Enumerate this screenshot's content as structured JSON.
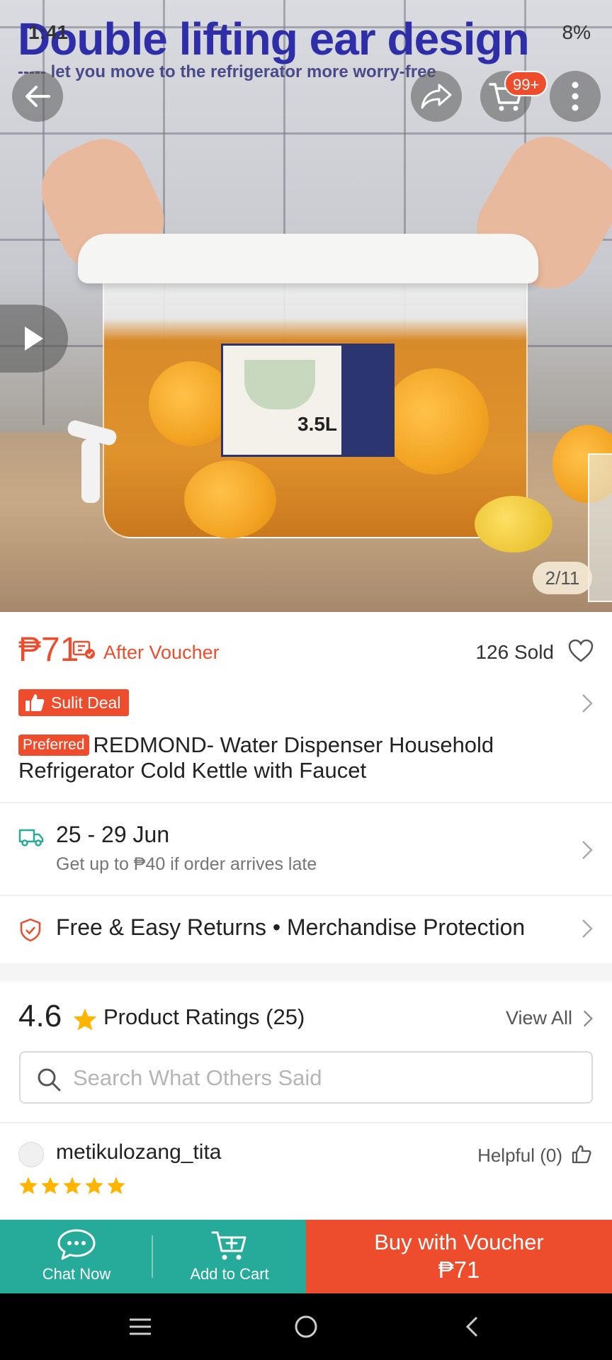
{
  "status_bar": {
    "time": "1:41",
    "battery": "8%"
  },
  "hero": {
    "overlay_title": "Double lifting ear design",
    "overlay_subtitle": "----- let you move to the refrigerator more worry-free",
    "cart_badge": "99+",
    "image_counter": "2/11",
    "label_size": "3.5L"
  },
  "product": {
    "price": "₱71",
    "after_voucher": "After Voucher",
    "sold": "126 Sold",
    "sulit_deal": "Sulit Deal",
    "preferred_tag": "Preferred",
    "title": "REDMOND- Water Dispenser Household Refrigerator Cold Kettle with Faucet"
  },
  "shipping": {
    "date_range": "25 - 29 Jun",
    "guarantee": "Get up to ₱40 if order arrives late"
  },
  "returns": {
    "text": "Free & Easy Returns  •  Merchandise Protection"
  },
  "ratings": {
    "score": "4.6",
    "title": "Product Ratings (25)",
    "view_all": "View All",
    "search_placeholder": "Search What Others Said"
  },
  "review": {
    "username": "metikulozang_tita",
    "helpful": "Helpful (0)",
    "stars": 5
  },
  "bottom_bar": {
    "chat_now": "Chat Now",
    "add_to_cart": "Add to Cart",
    "buy_label": "Buy with Voucher",
    "buy_price": "₱71"
  },
  "colors": {
    "brand": "#ee4d2d",
    "teal": "#26aa99",
    "star": "#ffb400"
  }
}
